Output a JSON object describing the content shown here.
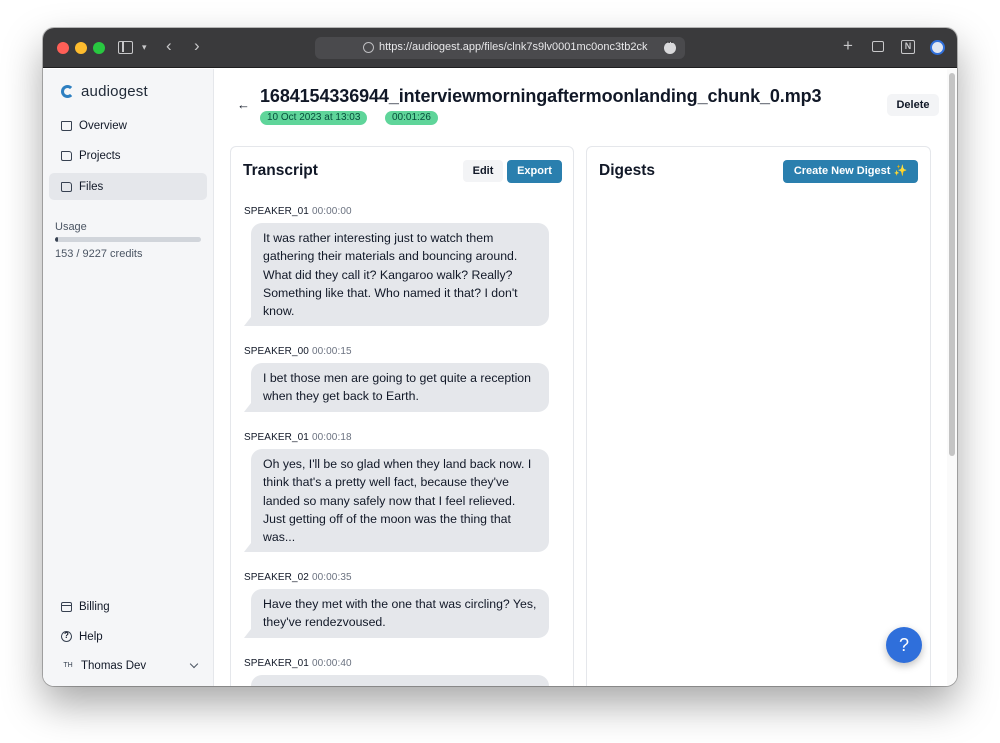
{
  "browser": {
    "url": "https://audiogest.app/files/clnk7s9lv0001mc0onc3tb2ck"
  },
  "sidebar": {
    "brand": "audiogest",
    "nav": [
      {
        "label": "Overview",
        "icon": "home-icon"
      },
      {
        "label": "Projects",
        "icon": "folder-icon"
      },
      {
        "label": "Files",
        "icon": "folder-icon",
        "active": true
      }
    ],
    "usage": {
      "label": "Usage",
      "text": "153 / 9227 credits",
      "used": 153,
      "total": 9227
    },
    "bottom_nav": [
      {
        "label": "Billing",
        "icon": "credit-card-icon"
      },
      {
        "label": "Help",
        "icon": "help-circle-icon",
        "glyph": "?"
      }
    ],
    "user": {
      "initials": "TH",
      "name": "Thomas Dev"
    }
  },
  "file": {
    "title": "1684154336944_interviewmorningaftermoonlanding_chunk_0.mp3",
    "date_badge": "10 Oct 2023 at 13:03",
    "duration_badge": "00:01:26",
    "delete_label": "Delete"
  },
  "transcript": {
    "title": "Transcript",
    "edit_label": "Edit",
    "export_label": "Export",
    "messages": [
      {
        "speaker": "SPEAKER_01",
        "time": "00:00:00",
        "text": "It was rather interesting just to watch them gathering their materials and bouncing around. What did they call it? Kangaroo walk? Really? Something like that. Who named it that? I don't know."
      },
      {
        "speaker": "SPEAKER_00",
        "time": "00:00:15",
        "text": "I bet those men are going to get quite a reception when they get back to Earth."
      },
      {
        "speaker": "SPEAKER_01",
        "time": "00:00:18",
        "text": "Oh yes, I'll be so glad when they land back now. I think that's a pretty well fact, because they've landed so many safely now that I feel relieved. Just getting off of the moon was the thing that was..."
      },
      {
        "speaker": "SPEAKER_02",
        "time": "00:00:35",
        "text": "Have they met with the one that was circling? Yes, they've rendezvoused."
      },
      {
        "speaker": "SPEAKER_01",
        "time": "00:00:40",
        "text": ""
      }
    ]
  },
  "digests": {
    "title": "Digests",
    "create_label": "Create New Digest ✨"
  },
  "help_fab": {
    "label": "?"
  },
  "colors": {
    "accent": "#2a7fae",
    "badge": "#5fd59a",
    "fab": "#2f6fdb"
  }
}
